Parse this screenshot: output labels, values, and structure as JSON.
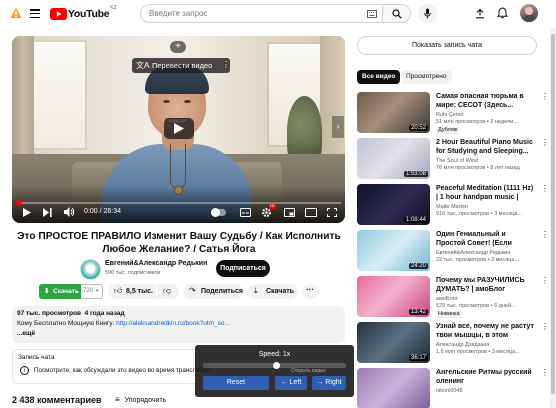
{
  "topbar": {
    "logo_text": "YouTube",
    "region": "KZ",
    "search_placeholder": "Введите запрос",
    "warning_color": "#f5a623",
    "brand_red": "#ff0000"
  },
  "player": {
    "translate_label": "Перевести видео",
    "time": "0:00 / 26:34",
    "progress": 0.01
  },
  "video": {
    "title": "Это ПРОСТОЕ ПРАВИЛО Изменит Вашу Судьбу / Как Исполнить Любое Желание? / Сатья Йога",
    "channel_name": "Евгений&Александр Редькин",
    "subscribers": "590 тыс. подписчиков",
    "subscribe_label": "Подписаться",
    "download_alt_label": "Скачать",
    "download_quality": "720",
    "likes": "8,5 тыс.",
    "share_label": "Поделиться",
    "download_label": "Скачать",
    "views_date": "97 тыс. просмотров  4 года назад",
    "description_text": "Кому Бесплатно Мощную Книгу:",
    "description_link": "http://aleksandredkin.ru/book?utm_so...",
    "description_more": "...ещё"
  },
  "chat_box": {
    "title": "Запись чата",
    "prompt": "Посмотрите, как обсуждали это видео во время трансляции."
  },
  "comments": {
    "count_label": "2 438 комментариев",
    "sort_label": "Упорядочить"
  },
  "sidebar": {
    "show_chat_label": "Показать запись чата",
    "chips": [
      "Все видео",
      "Просмотрено"
    ],
    "items": [
      {
        "title": "Самая опасная тюрьма в мире: СЕСОТ (Здесь...",
        "channel": "Ruhi Çenet",
        "meta": "51 млн просмотров  • 2 недели...",
        "badge": "Дубляж",
        "duration": "20:52"
      },
      {
        "title": "2 Hour Beautiful Piano Music for Studying and Sleeping...",
        "channel": "The Soul of Wind",
        "meta": "76 млн просмотров  • 8 лет назад",
        "badge": "",
        "duration": "1:53:08"
      },
      {
        "title": "Peaceful Meditation (1111 Hz) | 1 hour handpan music | Malte...",
        "channel": "Malte Marten",
        "meta": "916 тыс. просмотров  • 3 месяца...",
        "badge": "",
        "duration": "1:08:44"
      },
      {
        "title": "Один Гениальный и Простой Совет! (Если Хочешь Больш...",
        "channel": "Евгений&Александр Редькин",
        "meta": "22 тыс. просмотров  • 3 месяца...",
        "badge": "",
        "duration": "24:20"
      },
      {
        "title": "Почему мы РАЗУЧИЛИСЬ ДУМАТЬ? | амоБлог",
        "channel": "амоБлог",
        "meta": "529 тыс. просмотров  • 6 дней...",
        "badge": "Новинка",
        "duration": "13:42"
      },
      {
        "title": "Узнай все, почему не растут твои мышцы, в этом видео...",
        "channel": "Александр Дзядзаня",
        "meta": "1,6 млн просмотров  • 3 месяца...",
        "badge": "",
        "duration": "36:17"
      },
      {
        "title": "Ангельские Ритмы русский оленинг",
        "channel": "nikoni0048",
        "meta": "",
        "badge": "",
        "duration": ""
      }
    ]
  },
  "speed_overlay": {
    "label": "Speed: 1x",
    "reset_label": "Reset",
    "left_label": "← Left",
    "right_label": "→ Right",
    "hint": "Открыть видео"
  }
}
